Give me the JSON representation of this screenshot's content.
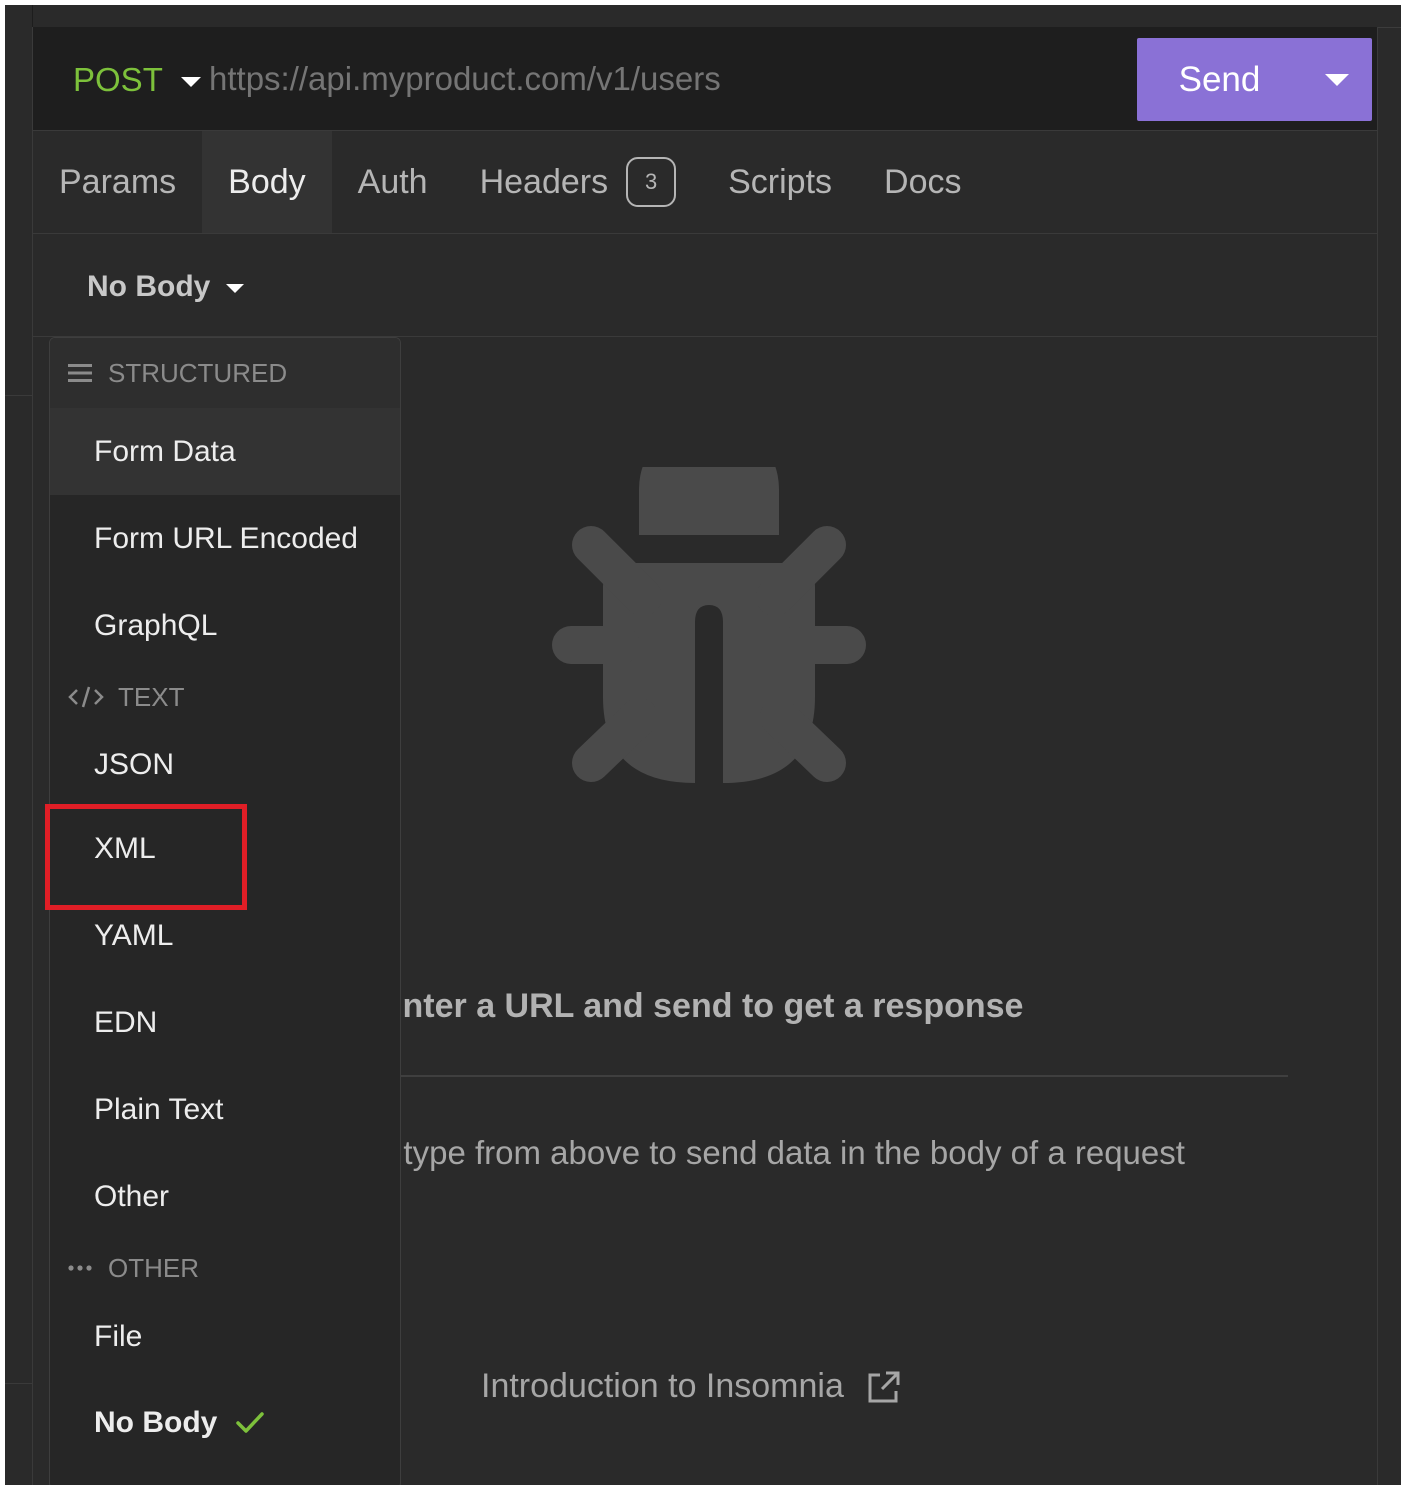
{
  "request": {
    "method": "POST",
    "url_placeholder": "https://api.myproduct.com/v1/users",
    "send_label": "Send",
    "method_color": "#7dc13b",
    "accent_color": "#8a71d6"
  },
  "tabs": [
    {
      "label": "Params"
    },
    {
      "label": "Body",
      "active": true
    },
    {
      "label": "Auth"
    },
    {
      "label": "Headers",
      "badge": "3"
    },
    {
      "label": "Scripts"
    },
    {
      "label": "Docs"
    }
  ],
  "body_selector": {
    "label": "No Body"
  },
  "menu": {
    "sections": [
      {
        "title": "STRUCTURED",
        "icon": "list-icon",
        "items": [
          "Form Data",
          "Form URL Encoded",
          "GraphQL"
        ]
      },
      {
        "title": "TEXT",
        "icon": "code-icon",
        "items": [
          "JSON",
          "XML",
          "YAML",
          "EDN",
          "Plain Text",
          "Other"
        ]
      },
      {
        "title": "OTHER",
        "icon": "ellipsis-icon",
        "items": [
          "File",
          "No Body"
        ]
      }
    ],
    "selected": "No Body",
    "highlighted": "XML"
  },
  "empty_state": {
    "title": "nter a URL and send to get a response",
    "description": "ody type from above to send data in the body of a request",
    "link_label": "Introduction to Insomnia",
    "icon": "bug-icon"
  },
  "colors": {
    "highlight_border": "#e01e26",
    "check": "#7dc13b"
  }
}
